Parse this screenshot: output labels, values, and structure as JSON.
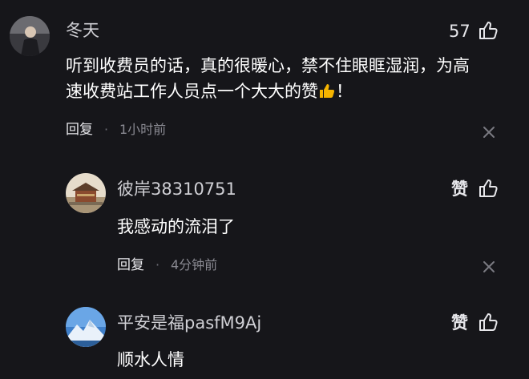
{
  "comments": [
    {
      "author": "冬天",
      "likes": "57",
      "text_line1": "听到收费员的话，真的很暖心，禁不住眼眶湿润，为高",
      "text_line2": "速收费站工作人员点一个大大的赞",
      "text_suffix": "！",
      "reply_label": "回复",
      "separator": "·",
      "time": "1小时前"
    },
    {
      "author": "彼岸38310751",
      "like_label": "赞",
      "text": "我感动的流泪了",
      "reply_label": "回复",
      "separator": "·",
      "time": "4分钟前"
    },
    {
      "author": "平安是福pasfM9Aj",
      "like_label": "赞",
      "text": "顺水人情"
    }
  ],
  "icons": {
    "thumb": "thumb-up-icon",
    "close": "close-icon",
    "emoji": "thumbs-up-emoji"
  },
  "colors": {
    "background": "#16161a",
    "text": "#ffffff",
    "muted": "#8a8a92",
    "emoji": "#f5b400"
  }
}
